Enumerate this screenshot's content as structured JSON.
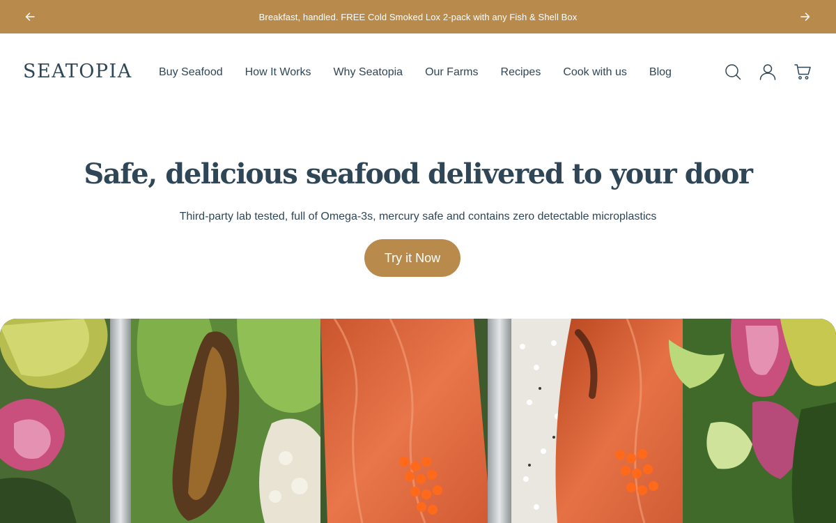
{
  "announcement": {
    "text": "Breakfast, handled. FREE Cold Smoked Lox 2-pack with any Fish & Shell Box",
    "prev_icon": "arrow-left-icon",
    "next_icon": "arrow-right-icon"
  },
  "header": {
    "logo": "SEATOPIA",
    "nav": [
      {
        "label": "Buy Seafood"
      },
      {
        "label": "How It Works"
      },
      {
        "label": "Why Seatopia"
      },
      {
        "label": "Our Farms"
      },
      {
        "label": "Recipes"
      },
      {
        "label": "Cook with us"
      },
      {
        "label": "Blog"
      }
    ],
    "icons": [
      "search-icon",
      "account-icon",
      "cart-icon"
    ]
  },
  "hero": {
    "title": "Safe, delicious seafood delivered to your door",
    "subtitle": "Third-party lab tested, full of Omega-3s, mercury safe and contains zero detectable microplastics",
    "cta_label": "Try it Now"
  },
  "colors": {
    "brand_gold": "#b88a4c",
    "text_navy": "#2f4656",
    "background": "#ffffff"
  }
}
